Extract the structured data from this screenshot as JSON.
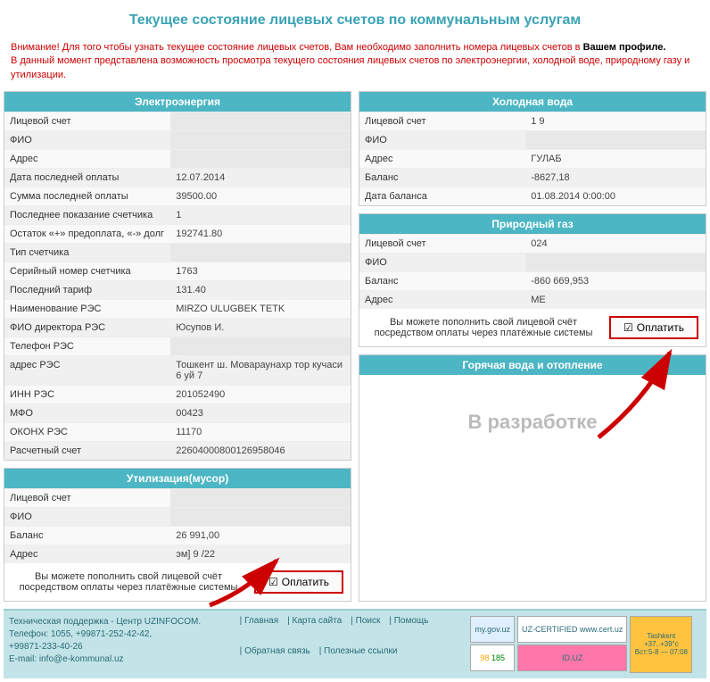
{
  "page_title": "Текущее состояние лицевых счетов по коммунальным услугам",
  "notice": {
    "line1a": "Внимание! Для того чтобы узнать текущее состояние лицевых счетов, Вам необходимо заполнить номера лицевых счетов в ",
    "line1b": "Вашем профиле.",
    "line2": "В данный момент представлена возможность просмотра текущего состояния лицевых счетов по электроэнергии, холодной воде, природному газу и утилизации."
  },
  "electro": {
    "title": "Электроэнергия",
    "rows": [
      {
        "label": "Лицевой счет",
        "value": ""
      },
      {
        "label": "ФИО",
        "value": ""
      },
      {
        "label": "Адрес",
        "value": ""
      },
      {
        "label": "Дата последней оплаты",
        "value": "12.07.2014"
      },
      {
        "label": "Сумма последней оплаты",
        "value": "39500.00"
      },
      {
        "label": "Последнее показание счетчика",
        "value": "1"
      },
      {
        "label": "Остаток «+» предоплата, «-» долг",
        "value": "192741.80"
      },
      {
        "label": "Тип счетчика",
        "value": ""
      },
      {
        "label": "Серийный номер счетчика",
        "value": "1763"
      },
      {
        "label": "Последний тариф",
        "value": "131.40"
      },
      {
        "label": "Наименование РЭС",
        "value": "MIRZO ULUGBEK TETK"
      },
      {
        "label": "ФИО директора РЭС",
        "value": "Юсупов И."
      },
      {
        "label": "Телефон РЭС",
        "value": ""
      },
      {
        "label": "адрес РЭС",
        "value": "Тошкент ш. Мовараунахр тор кучаси 6 уй 7"
      },
      {
        "label": "ИНН РЭС",
        "value": "201052490"
      },
      {
        "label": "МФО",
        "value": "00423"
      },
      {
        "label": "ОКОНХ РЭС",
        "value": "11170"
      },
      {
        "label": "Расчетный счет",
        "value": "22604000800126958046"
      }
    ]
  },
  "coldwater": {
    "title": "Холодная вода",
    "rows": [
      {
        "label": "Лицевой счет",
        "value": "1 9"
      },
      {
        "label": "ФИО",
        "value": ""
      },
      {
        "label": "Адрес",
        "value": "ГУЛАБ"
      },
      {
        "label": "Баланс",
        "value": "-8627,18"
      },
      {
        "label": "Дата баланса",
        "value": "01.08.2014 0:00:00"
      }
    ]
  },
  "gas": {
    "title": "Природный газ",
    "rows": [
      {
        "label": "Лицевой счет",
        "value": "024"
      },
      {
        "label": "ФИО",
        "value": ""
      },
      {
        "label": "Баланс",
        "value": "-860 669,953"
      },
      {
        "label": "Адрес",
        "value": "МE"
      }
    ],
    "pay_text": "Вы можете пополнить свой лицевой счёт посредством оплаты через платёжные системы",
    "pay_btn": "Оплатить"
  },
  "util": {
    "title": "Утилизация(мусор)",
    "rows": [
      {
        "label": "Лицевой счет",
        "value": ""
      },
      {
        "label": "ФИО",
        "value": ""
      },
      {
        "label": "Баланс",
        "value": "26 991,00"
      },
      {
        "label": "Адрес",
        "value": "эм] 9 /22"
      }
    ],
    "pay_text": "Вы можете пополнить свой лицевой счёт посредством оплаты через платёжные системы",
    "pay_btn": "Оплатить"
  },
  "hotwater": {
    "title": "Горячая вода и отопление",
    "in_dev": "В разработке"
  },
  "footer": {
    "support1": "Техническая поддержка - Центр UZINFOCOM.",
    "support2": "Телефон: 1055, +99871-252-42-42,",
    "support3": "+99871-233-40-26",
    "support4": "E-mail: info@e-kommunal.uz",
    "links": [
      "Главная",
      "Карта сайта",
      "Поиск",
      "Помощь",
      "Обратная связь",
      "Полезные ссылки"
    ],
    "badges": {
      "mygov": "my.gov.uz",
      "cert": "UZ-CERTIFIED www.cert.uz",
      "stat1": "98",
      "stat2": "185",
      "iduz": "ID.UZ",
      "weather_city": "Tashkent",
      "weather_temp": "+37..+39°c",
      "weather_time": "Вст:5-8 — 07:08"
    }
  }
}
